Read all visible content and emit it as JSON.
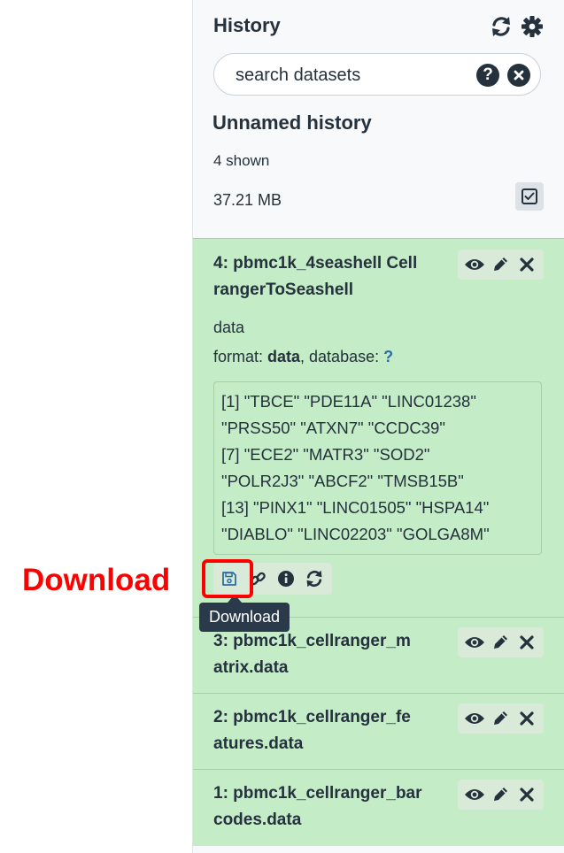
{
  "header": {
    "title": "History"
  },
  "search": {
    "placeholder": "search datasets"
  },
  "history": {
    "name": "Unnamed history",
    "shown": "4 shown",
    "size": "37.21 MB"
  },
  "datasets": [
    {
      "title_line1": "4: pbmc1k_4seashell Cell",
      "title_line2": "rangerToSeashell",
      "info": "data",
      "format_prefix": "format: ",
      "format_value": "data",
      "database_prefix": ", database: ",
      "database_value": "?",
      "peek": [
        "[1] \"TBCE\" \"PDE11A\" \"LINC01238\"",
        "\"PRSS50\" \"ATXN7\" \"CCDC39\"",
        "[7] \"ECE2\" \"MATR3\" \"SOD2\"",
        "\"POLR2J3\" \"ABCF2\" \"TMSB15B\"",
        "[13] \"PINX1\" \"LINC01505\" \"HSPA14\"",
        "\"DIABLO\" \"LINC02203\" \"GOLGA8M\""
      ]
    },
    {
      "title_line1": "3: pbmc1k_cellranger_m",
      "title_line2": "atrix.data"
    },
    {
      "title_line1": "2: pbmc1k_cellranger_fe",
      "title_line2": "atures.data"
    },
    {
      "title_line1": "1: pbmc1k_cellranger_bar",
      "title_line2": "codes.data"
    }
  ],
  "tooltip": {
    "text": "Download"
  },
  "annotation": {
    "label": "Download",
    "color": "#ff0000"
  },
  "icons": {
    "refresh": "refresh-icon",
    "settings": "gear-icon",
    "help": "question-icon",
    "clear": "close-circle-icon",
    "select_all": "checkbox-icon",
    "view": "eye-icon",
    "edit": "pencil-icon",
    "delete": "close-icon",
    "download": "floppy-disk-icon",
    "link": "link-icon",
    "info": "info-icon",
    "rerun": "refresh-icon"
  },
  "colors": {
    "dataset_ok": "#c3ecc7",
    "text": "#25313d",
    "highlight": "#ff0000"
  }
}
